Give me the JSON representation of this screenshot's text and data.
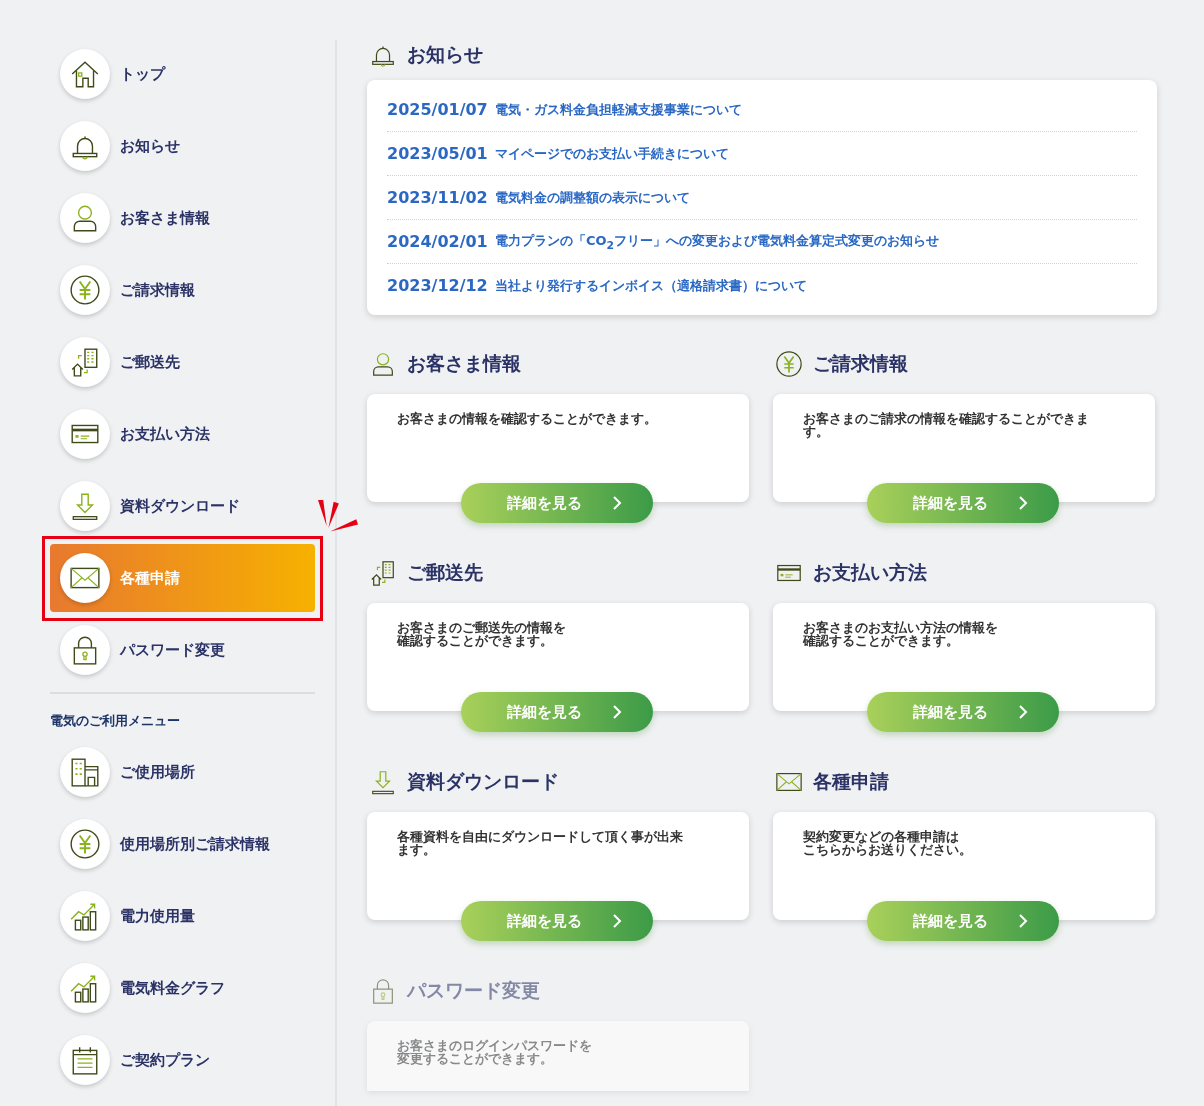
{
  "sidebar": {
    "items": [
      {
        "label": "トップ",
        "selected": false,
        "highlighted": false
      },
      {
        "label": "お知らせ",
        "selected": false,
        "highlighted": false
      },
      {
        "label": "お客さま情報",
        "selected": false,
        "highlighted": false
      },
      {
        "label": "ご請求情報",
        "selected": false,
        "highlighted": false
      },
      {
        "label": "ご郵送先",
        "selected": false,
        "highlighted": false
      },
      {
        "label": "お支払い方法",
        "selected": false,
        "highlighted": false
      },
      {
        "label": "資料ダウンロード",
        "selected": false,
        "highlighted": false
      },
      {
        "label": "各種申請",
        "selected": true,
        "highlighted": true
      },
      {
        "label": "パスワード変更",
        "selected": false,
        "highlighted": false
      }
    ],
    "section_title": "電気のご利用メニュー",
    "section_items": [
      {
        "label": "ご使用場所",
        "selected": false
      },
      {
        "label": "使用場所別ご請求情報",
        "selected": false
      },
      {
        "label": "電力使用量",
        "selected": false
      },
      {
        "label": "電気料金グラフ",
        "selected": false
      },
      {
        "label": "ご契約プラン",
        "selected": false
      }
    ]
  },
  "news": {
    "title": "お知らせ",
    "items": [
      {
        "date": "2025/01/07",
        "title": "電気・ガス料金負担軽減支援事業について"
      },
      {
        "date": "2023/05/01",
        "title": "マイページでのお支払い手続きについて"
      },
      {
        "date": "2023/11/02",
        "title": "電気料金の調整額の表示について"
      },
      {
        "date": "2024/02/01",
        "title": "電力プランの「CO$_{2}$フリー」への変更および電気料金算定式変更のお知らせ"
      },
      {
        "date": "2023/12/12",
        "title": "当社より発行するインボイス（適格請求書）について"
      }
    ]
  },
  "cards": [
    {
      "title": "お客さま情報",
      "description_lines": [
        "お客さまの情報を確認することができます。"
      ],
      "button": "詳細を見る",
      "disabled": false
    },
    {
      "title": "ご請求情報",
      "description_lines": [
        "お客さまのご請求の情報を確認することができま",
        "す。"
      ],
      "button": "詳細を見る",
      "disabled": false
    },
    {
      "title": "ご郵送先",
      "description_lines": [
        "お客さまのご郵送先の情報を",
        "確認することができます。"
      ],
      "button": "詳細を見る",
      "disabled": false
    },
    {
      "title": "お支払い方法",
      "description_lines": [
        "お客さまのお支払い方法の情報を",
        "確認することができます。"
      ],
      "button": "詳細を見る",
      "disabled": false
    },
    {
      "title": "資料ダウンロード",
      "description_lines": [
        "各種資料を自由にダウンロードして頂く事が出来",
        "ます。"
      ],
      "button": "詳細を見る",
      "disabled": false
    },
    {
      "title": "各種申請",
      "description_lines": [
        "契約変更などの各種申請は",
        "こちらからお送りください。"
      ],
      "button": "詳細を見る",
      "disabled": false
    },
    {
      "title": "パスワード変更",
      "description_lines": [
        "お客さまのログインパスワードを",
        "変更することができます。"
      ],
      "disabled": true
    }
  ]
}
